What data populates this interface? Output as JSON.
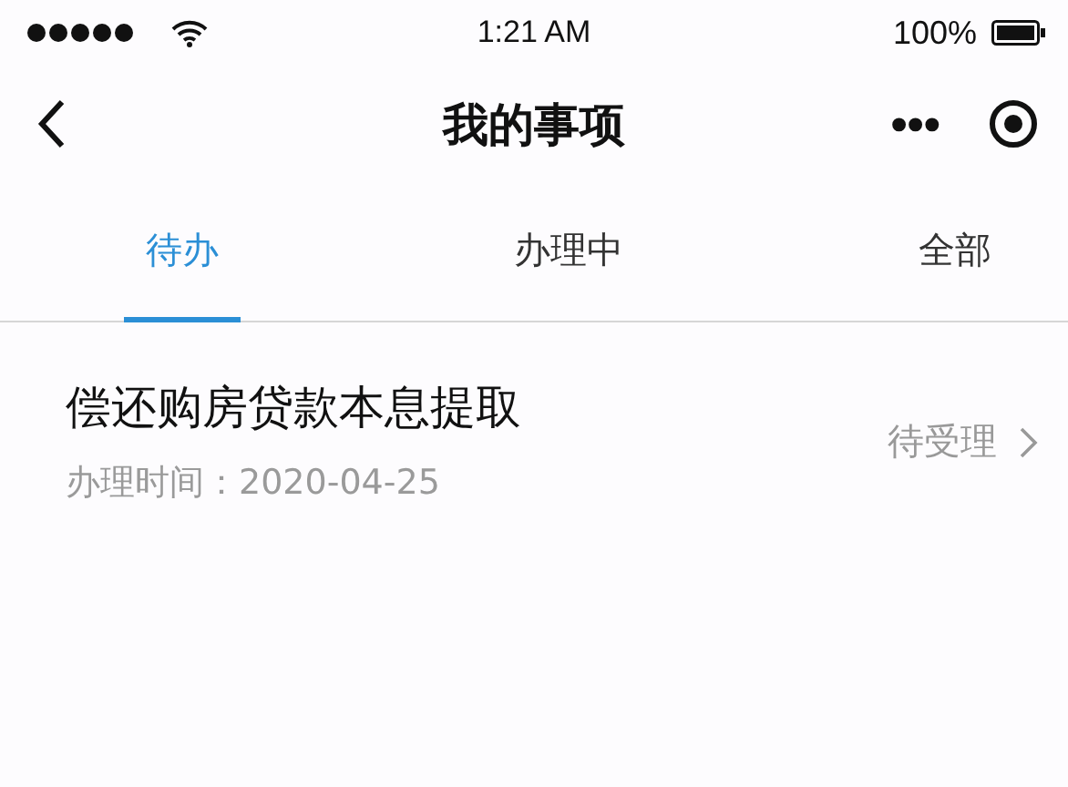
{
  "status_bar": {
    "time": "1:21 AM",
    "battery": "100%"
  },
  "nav": {
    "title": "我的事项",
    "more": "•••"
  },
  "tabs": [
    {
      "label": "待办",
      "selected": true
    },
    {
      "label": "办理中",
      "selected": false
    },
    {
      "label": "全部",
      "selected": false
    }
  ],
  "items": [
    {
      "title": "偿还购房贷款本息提取",
      "subtitle": "办理时间：2020-04-25",
      "status": "待受理"
    }
  ]
}
